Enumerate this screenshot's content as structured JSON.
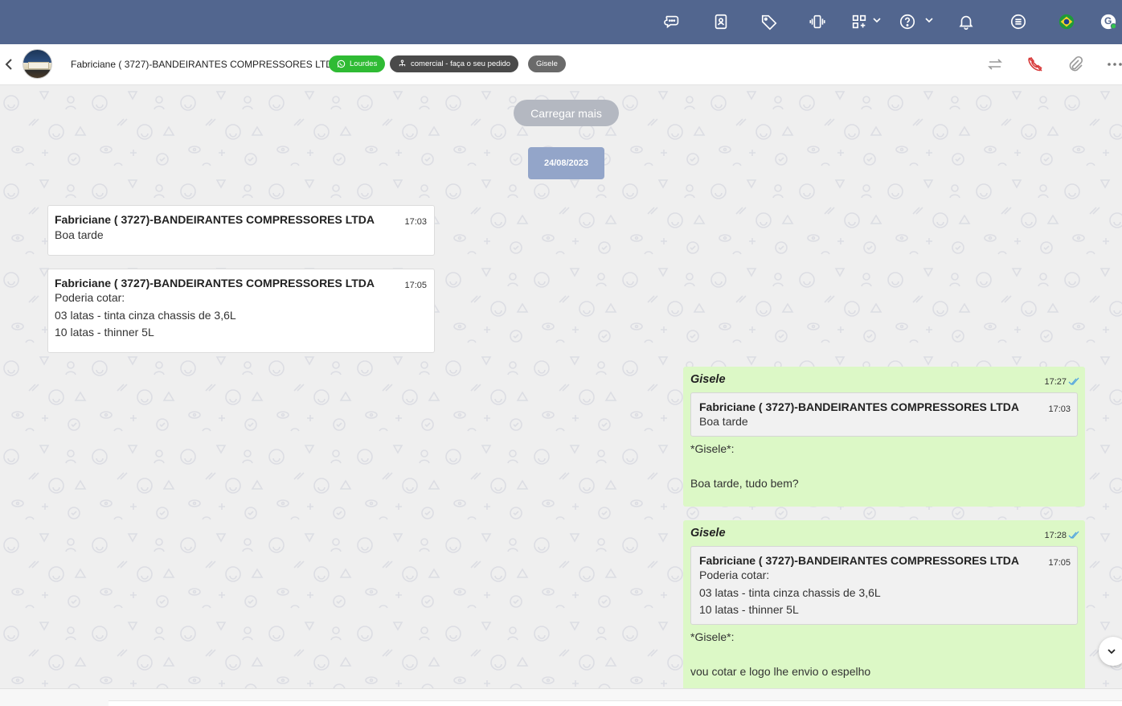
{
  "topbar": {
    "icons": [
      "chat-bubbles-icon",
      "contact-book-icon",
      "tag-icon",
      "vibrate-phone-icon",
      "apps-grid-icon",
      "help-icon",
      "bell-icon",
      "menu-list-icon",
      "brazil-flag-icon",
      "user-avatar-icon"
    ],
    "user_initial": "G",
    "color": "#52668f"
  },
  "header": {
    "contact_name": "Fabriciane ( 3727)-BANDEIRANTES COMPRESSORES LTDA",
    "chips": {
      "whatsapp_agent": "Lourdes",
      "queue": "comercial - faça o seu pedido",
      "user": "Gisele"
    },
    "actions": [
      "transfer-icon",
      "end-call-icon",
      "attach-icon",
      "more-icon"
    ]
  },
  "chat": {
    "load_more": "Carregar mais",
    "date": "24/08/2023",
    "incoming": [
      {
        "sender": "Fabriciane ( 3727)-BANDEIRANTES COMPRESSORES LTDA",
        "time": "17:03",
        "lines": [
          "Boa tarde"
        ]
      },
      {
        "sender": "Fabriciane ( 3727)-BANDEIRANTES COMPRESSORES LTDA",
        "time": "17:05",
        "lines": [
          "Poderia cotar:",
          "03 latas - tinta cinza chassis de 3,6L",
          "10 latas - thinner 5L"
        ]
      }
    ],
    "outgoing": [
      {
        "author": "Gisele",
        "time": "17:27",
        "quote": {
          "sender": "Fabriciane ( 3727)-BANDEIRANTES COMPRESSORES LTDA",
          "time": "17:03",
          "lines": [
            "Boa tarde"
          ]
        },
        "text": "*Gisele*:\n\nBoa tarde, tudo bem?"
      },
      {
        "author": "Gisele",
        "time": "17:28",
        "quote": {
          "sender": "Fabriciane ( 3727)-BANDEIRANTES COMPRESSORES LTDA",
          "time": "17:05",
          "lines": [
            "Poderia cotar:",
            "03 latas - tinta cinza chassis de 3,6L",
            "10 latas - thinner 5L"
          ]
        },
        "text": "*Gisele*:\n\nvou cotar e logo lhe envio o espelho"
      }
    ],
    "colors": {
      "incoming_bg": "#ffffff",
      "outgoing_bg": "#dcf8c6",
      "date_badge": "#93a5c9",
      "whatsapp_chip": "#2fbb34",
      "read_ticks": "#4fa3e0"
    }
  }
}
